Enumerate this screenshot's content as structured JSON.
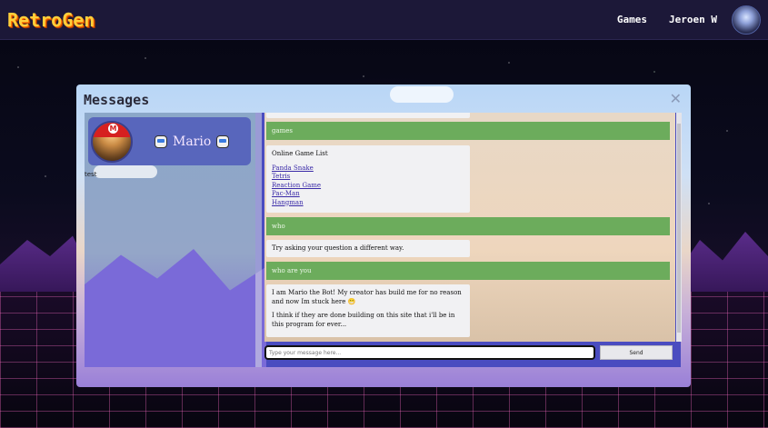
{
  "header": {
    "logo": "RetroGen",
    "nav": [
      "Games",
      "Jeroen W"
    ]
  },
  "modal": {
    "title": "Messages",
    "close": "✕"
  },
  "contact": {
    "name": "Mario",
    "subtext": "test"
  },
  "chat": {
    "messages": [
      {
        "from": "user",
        "text": "games"
      },
      {
        "from": "bot",
        "title": "Online Game List",
        "links": [
          "Panda Snake",
          "Tetris",
          "Reaction Game",
          "Pac-Man",
          "Hangman"
        ]
      },
      {
        "from": "user",
        "text": "who"
      },
      {
        "from": "bot",
        "text": "Try asking your question a different way."
      },
      {
        "from": "user",
        "text": "who are you"
      },
      {
        "from": "bot",
        "paragraphs": [
          "I am Mario the Bot! My creator has build me for no reason and now Im stuck here 😁",
          "I think if they are done building on this site that i'll be in this program for ever..."
        ]
      }
    ]
  },
  "composer": {
    "placeholder": "Type your message here...",
    "send_label": "Send"
  },
  "colors": {
    "user_bubble": "#6cac5c",
    "bot_bubble": "#f1f1f3",
    "topbar": "#1c1838",
    "logo": "#ffcf3a"
  }
}
